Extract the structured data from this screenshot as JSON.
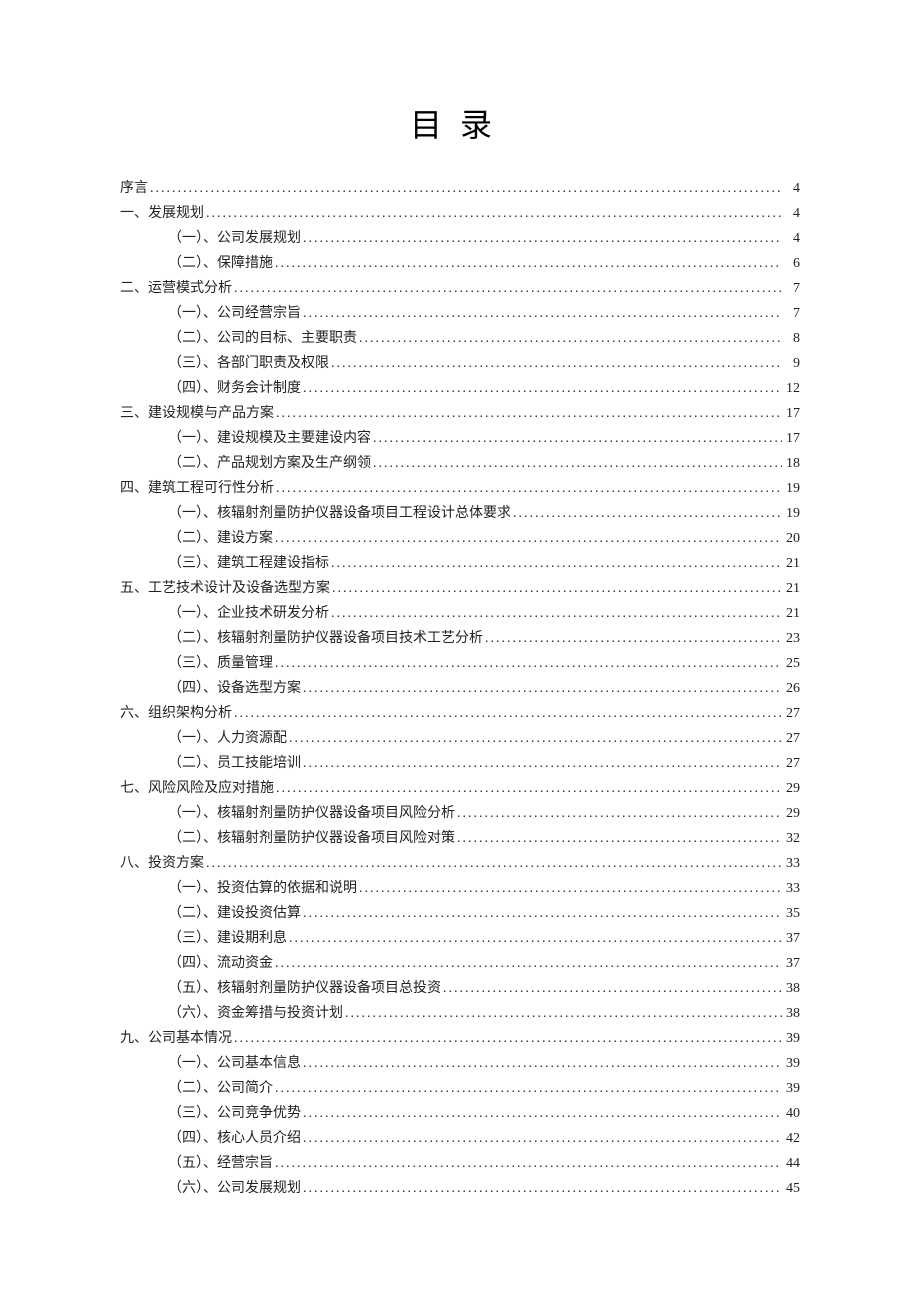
{
  "title": "目录",
  "toc": [
    {
      "level": 1,
      "text": "序言",
      "page": "4"
    },
    {
      "level": 1,
      "text": "一、发展规划",
      "page": "4"
    },
    {
      "level": 2,
      "text": "（一）、公司发展规划",
      "page": "4"
    },
    {
      "level": 2,
      "text": "（二）、保障措施",
      "page": "6"
    },
    {
      "level": 1,
      "text": "二、运营模式分析",
      "page": "7"
    },
    {
      "level": 2,
      "text": "（一）、公司经营宗旨",
      "page": "7"
    },
    {
      "level": 2,
      "text": "（二）、公司的目标、主要职责",
      "page": "8"
    },
    {
      "level": 2,
      "text": "（三）、各部门职责及权限",
      "page": "9"
    },
    {
      "level": 2,
      "text": "（四）、财务会计制度",
      "page": "12"
    },
    {
      "level": 1,
      "text": "三、建设规模与产品方案",
      "page": "17"
    },
    {
      "level": 2,
      "text": "（一）、建设规模及主要建设内容",
      "page": "17"
    },
    {
      "level": 2,
      "text": "（二）、产品规划方案及生产纲领",
      "page": "18"
    },
    {
      "level": 1,
      "text": "四、建筑工程可行性分析",
      "page": "19"
    },
    {
      "level": 2,
      "text": "（一）、核辐射剂量防护仪器设备项目工程设计总体要求",
      "page": "19"
    },
    {
      "level": 2,
      "text": "（二）、建设方案",
      "page": "20"
    },
    {
      "level": 2,
      "text": "（三）、建筑工程建设指标",
      "page": "21"
    },
    {
      "level": 1,
      "text": "五、工艺技术设计及设备选型方案",
      "page": "21"
    },
    {
      "level": 2,
      "text": "（一）、企业技术研发分析",
      "page": "21"
    },
    {
      "level": 2,
      "text": "（二）、核辐射剂量防护仪器设备项目技术工艺分析",
      "page": "23"
    },
    {
      "level": 2,
      "text": "（三）、质量管理",
      "page": "25"
    },
    {
      "level": 2,
      "text": "（四）、设备选型方案",
      "page": "26"
    },
    {
      "level": 1,
      "text": "六、组织架构分析",
      "page": "27"
    },
    {
      "level": 2,
      "text": "（一）、人力资源配",
      "page": "27"
    },
    {
      "level": 2,
      "text": "（二）、员工技能培训",
      "page": "27"
    },
    {
      "level": 1,
      "text": "七、风险风险及应对措施",
      "page": "29"
    },
    {
      "level": 2,
      "text": "（一）、核辐射剂量防护仪器设备项目风险分析",
      "page": "29"
    },
    {
      "level": 2,
      "text": "（二）、核辐射剂量防护仪器设备项目风险对策",
      "page": "32"
    },
    {
      "level": 1,
      "text": "八、投资方案",
      "page": "33"
    },
    {
      "level": 2,
      "text": "（一）、投资估算的依据和说明",
      "page": "33"
    },
    {
      "level": 2,
      "text": "（二）、建设投资估算",
      "page": "35"
    },
    {
      "level": 2,
      "text": "（三）、建设期利息",
      "page": "37"
    },
    {
      "level": 2,
      "text": "（四）、流动资金",
      "page": "37"
    },
    {
      "level": 2,
      "text": "（五）、核辐射剂量防护仪器设备项目总投资",
      "page": "38"
    },
    {
      "level": 2,
      "text": "（六）、资金筹措与投资计划",
      "page": "38"
    },
    {
      "level": 1,
      "text": "九、公司基本情况",
      "page": "39"
    },
    {
      "level": 2,
      "text": "（一）、公司基本信息",
      "page": "39"
    },
    {
      "level": 2,
      "text": "（二）、公司简介",
      "page": "39"
    },
    {
      "level": 2,
      "text": "（三）、公司竞争优势",
      "page": "40"
    },
    {
      "level": 2,
      "text": "（四）、核心人员介绍",
      "page": "42"
    },
    {
      "level": 2,
      "text": "（五）、经营宗旨",
      "page": "44"
    },
    {
      "level": 2,
      "text": "（六）、公司发展规划",
      "page": "45"
    }
  ]
}
